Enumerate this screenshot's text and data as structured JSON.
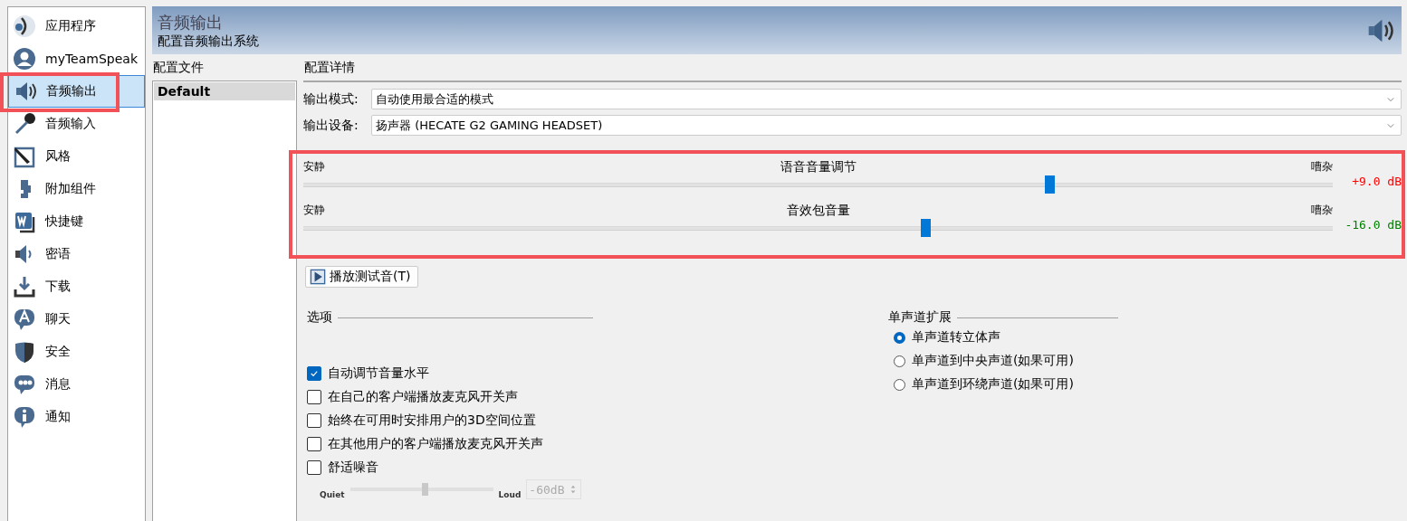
{
  "sidebar": {
    "items": [
      {
        "label": "应用程序",
        "selected": false,
        "annotated": false
      },
      {
        "label": "myTeamSpeak",
        "selected": false,
        "annotated": false
      },
      {
        "label": "音频输出",
        "selected": true,
        "annotated": true
      },
      {
        "label": "音频输入",
        "selected": false,
        "annotated": false
      },
      {
        "label": "风格",
        "selected": false,
        "annotated": false
      },
      {
        "label": "附加组件",
        "selected": false,
        "annotated": false
      },
      {
        "label": "快捷键",
        "selected": false,
        "annotated": false
      },
      {
        "label": "密语",
        "selected": false,
        "annotated": false
      },
      {
        "label": "下载",
        "selected": false,
        "annotated": false
      },
      {
        "label": "聊天",
        "selected": false,
        "annotated": false
      },
      {
        "label": "安全",
        "selected": false,
        "annotated": false
      },
      {
        "label": "消息",
        "selected": false,
        "annotated": false
      },
      {
        "label": "通知",
        "selected": false,
        "annotated": false
      }
    ]
  },
  "header": {
    "title": "音频输出",
    "subtitle": "配置音频输出系统"
  },
  "profiles": {
    "heading": "配置文件",
    "items": [
      {
        "label": "Default",
        "selected": true
      }
    ]
  },
  "details": {
    "heading": "配置详情",
    "fields": [
      {
        "label": "输出模式:",
        "value": "自动使用最合适的模式"
      },
      {
        "label": "输出设备:",
        "value": "扬声器 (HECATE G2 GAMING HEADSET)"
      }
    ],
    "volume": {
      "annotated": true,
      "sliders": [
        {
          "min_label": "安静",
          "title": "语音音量调节",
          "max_label": "嘈杂",
          "level": 0.72,
          "reading": "+9.0 dB",
          "color": "#ff0000"
        },
        {
          "min_label": "安静",
          "title": "音效包音量",
          "max_label": "嘈杂",
          "level": 0.6,
          "reading": "-16.0 dB",
          "color": "#008000"
        }
      ]
    },
    "test_button": "播放测试音(T)",
    "options": {
      "heading": "选项",
      "checkboxes": [
        {
          "label": "自动调节音量水平",
          "checked": true
        },
        {
          "label": "在自己的客户端播放麦克风开关声",
          "checked": false
        },
        {
          "label": "始终在可用时安排用户的3D空间位置",
          "checked": false
        },
        {
          "label": "在其他用户的客户端播放麦克风开关声",
          "checked": false
        },
        {
          "label": "舒适噪音",
          "checked": false
        }
      ],
      "noise": {
        "min_label": "Quiet",
        "max_label": "Loud",
        "level": 0.5,
        "value": "-60dB",
        "disabled": true
      }
    },
    "mono": {
      "heading": "单声道扩展",
      "radios": [
        {
          "label": "单声道转立体声",
          "selected": true
        },
        {
          "label": "单声道到中央声道(如果可用)",
          "selected": false
        },
        {
          "label": "单声道到环绕声道(如果可用)",
          "selected": false
        }
      ]
    }
  }
}
